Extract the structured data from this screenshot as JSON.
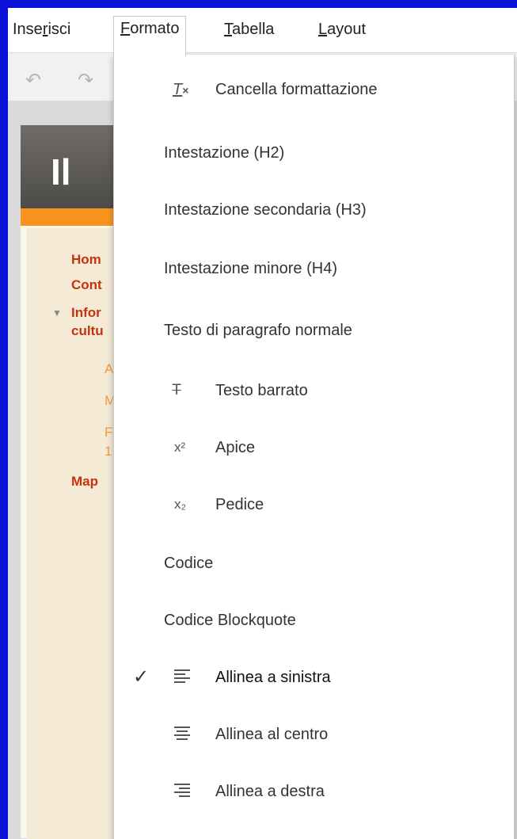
{
  "menubar": {
    "insert": {
      "pre": "Inse",
      "ul": "r",
      "post": "isci"
    },
    "format": {
      "pre": "",
      "ul": "F",
      "post": "ormato"
    },
    "table": {
      "pre": "",
      "ul": "T",
      "post": "abella"
    },
    "layout": {
      "pre": "",
      "ul": "L",
      "post": "ayout"
    }
  },
  "page": {
    "site_title": "Il",
    "sidebar": {
      "home": "Hom",
      "contacts": "Cont",
      "info": "Infor",
      "info_line2": "cultu",
      "sub1": "A",
      "sub2": "M",
      "sub3": "F",
      "sub3_line2": "1",
      "map": "Map"
    }
  },
  "dropdown": {
    "items": [
      {
        "label": "Cancella formattazione",
        "icon": "clear-format-icon"
      },
      {
        "label": "Intestazione (H2)"
      },
      {
        "label": "Intestazione secondaria (H3)"
      },
      {
        "label": "Intestazione minore (H4)"
      },
      {
        "label": "Testo di paragrafo normale"
      },
      {
        "label": "Testo barrato",
        "icon": "strikethrough-icon"
      },
      {
        "label": "Apice",
        "icon": "superscript-icon"
      },
      {
        "label": "Pedice",
        "icon": "subscript-icon"
      },
      {
        "label": "Codice"
      },
      {
        "label": "Codice Blockquote"
      },
      {
        "label": "Allinea a sinistra",
        "icon": "align-left-icon",
        "checked": true
      },
      {
        "label": "Allinea al centro",
        "icon": "align-center-icon"
      },
      {
        "label": "Allinea a destra",
        "icon": "align-right-icon"
      }
    ]
  },
  "colors": {
    "frame": "#0a10d8",
    "link": "#c3340c",
    "orange": "#f7931e"
  }
}
